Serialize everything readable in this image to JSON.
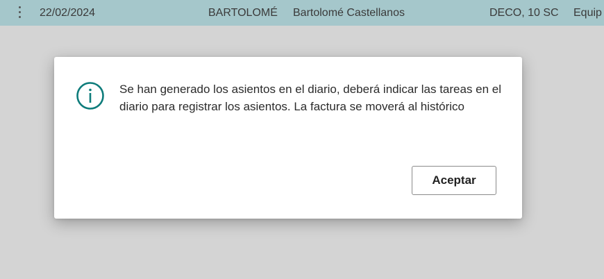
{
  "background_row": {
    "date": "22/02/2024",
    "code": "BARTOLOMÉ",
    "name": "Bartolomé Castellanos",
    "department": "DECO, 10 SC",
    "category": "Equip"
  },
  "dialog": {
    "icon": "info-icon",
    "message": "Se han generado los asientos en el diario, deberá indicar las tareas en el diario para registrar los asientos. La factura se moverá al histórico",
    "accept_label": "Aceptar"
  },
  "colors": {
    "row_background": "#a5c7cb",
    "overlay": "#d4d4d4",
    "icon_accent": "#0e7c7b"
  }
}
